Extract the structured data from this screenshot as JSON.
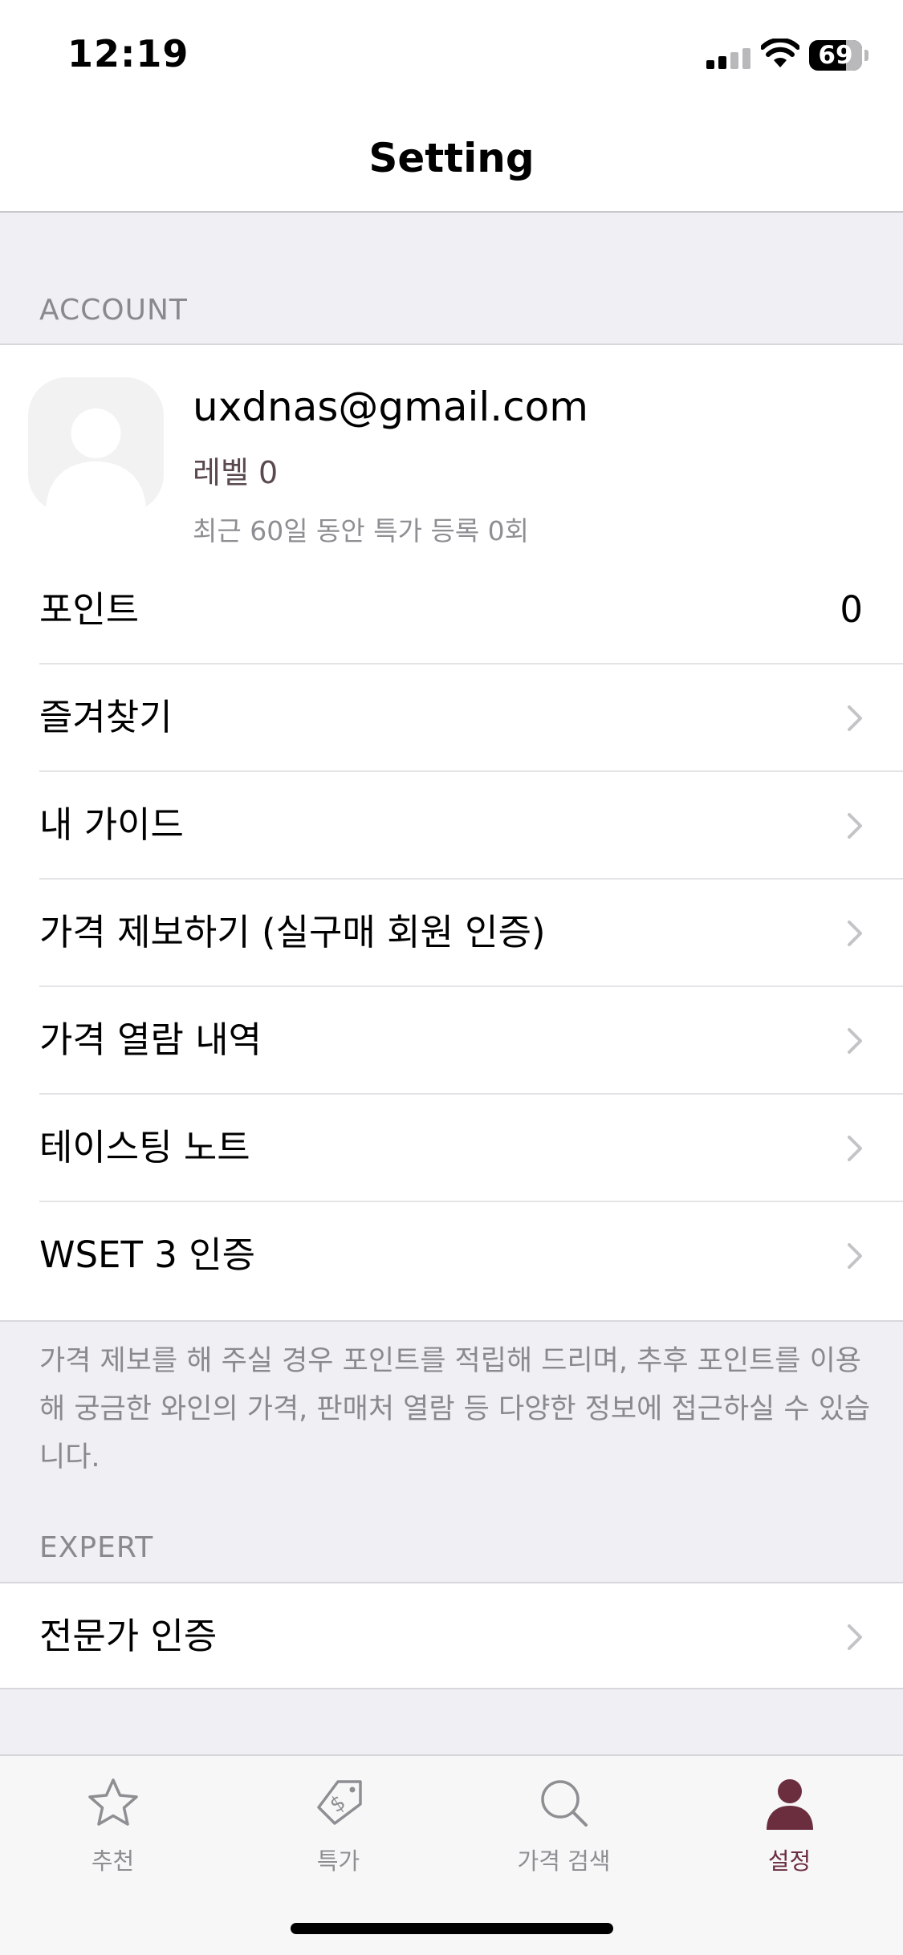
{
  "status_bar": {
    "time": "12:19",
    "battery_level": 69,
    "battery_text": "69"
  },
  "nav": {
    "title": "Setting"
  },
  "account_section": {
    "header": "ACCOUNT",
    "profile": {
      "email": "uxdnas@gmail.com",
      "level": "레벨 0",
      "stat": "최근 60일 동안 특가 등록 0회"
    },
    "rows": [
      {
        "label": "포인트",
        "value": "0"
      },
      {
        "label": "즐겨찾기"
      },
      {
        "label": "내 가이드"
      },
      {
        "label": "가격 제보하기 (실구매 회원 인증)"
      },
      {
        "label": "가격 열람 내역"
      },
      {
        "label": "테이스팅 노트"
      },
      {
        "label": "WSET 3 인증"
      }
    ],
    "footnote": "가격 제보를 해 주실 경우 포인트를 적립해 드리며, 추후 포인트를 이용해 궁금한 와인의 가격, 판매처 열람 등 다양한 정보에 접근하실 수 있습니다."
  },
  "expert_section": {
    "header": "EXPERT",
    "rows": [
      {
        "label": "전문가 인증"
      }
    ]
  },
  "tab_bar": {
    "tabs": [
      {
        "label": "추천",
        "icon": "star-icon"
      },
      {
        "label": "특가",
        "icon": "price-tag-icon"
      },
      {
        "label": "가격 검색",
        "icon": "search-icon"
      },
      {
        "label": "설정",
        "icon": "person-icon",
        "active": true
      }
    ]
  },
  "colors": {
    "accent": "#6b2e3f",
    "background": "#efeff4",
    "secondary_text": "#8a8a8e"
  }
}
